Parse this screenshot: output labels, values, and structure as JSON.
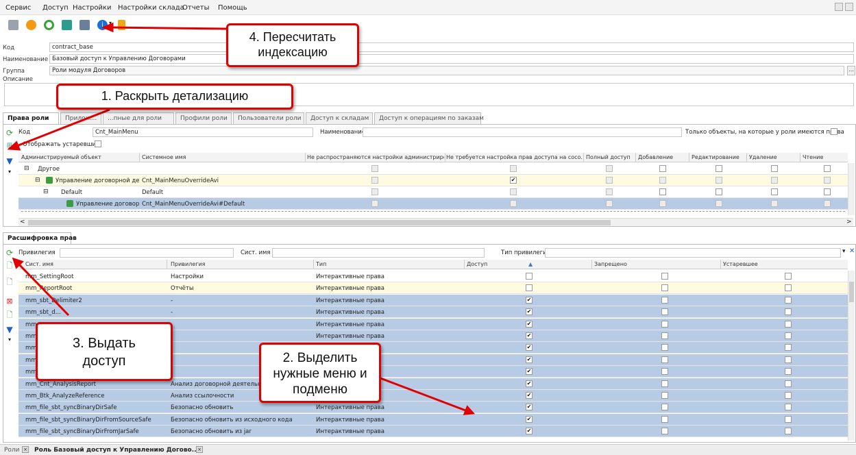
{
  "menu": [
    "Сервис",
    "Доступ",
    "Настройки",
    "Настройки склада",
    "Отчеты",
    "Помощь"
  ],
  "form": {
    "code_label": "Код",
    "code_value": "contract_base",
    "name_label": "Наименование",
    "name_value": "Базовый доступ к Управлению Договорами",
    "group_label": "Группа",
    "group_value": "Роли модуля Договоров",
    "desc_label": "Описание",
    "group_btn": "..."
  },
  "tabs_top": [
    "Права роли",
    "Прилож...",
    "...пные для роли",
    "Профили роли",
    "Пользователи роли",
    "Доступ к складам",
    "Доступ к операциям по заказам"
  ],
  "filter_top": {
    "code_label": "Код",
    "code_value": "Cnt_MainMenu",
    "name_label": "Наименование",
    "only_label": "Только объекты, на которые у роли имеются права",
    "show_obsolete": "Отображать устаревшие"
  },
  "grid1": {
    "columns": [
      "Администрируемый объект",
      "Системное имя",
      "Не распространяются настройки администриро...",
      "Не требуется настройка прав доступа на сосo...",
      "Полный доступ",
      "Добавление",
      "Редактирование",
      "Удаление",
      "Чтение"
    ],
    "rows": [
      {
        "obj": "Другое",
        "sys": ""
      },
      {
        "obj": "Управление договорной деятел",
        "sys": "Cnt_MainMenuOverrideAvi"
      },
      {
        "obj": "Default",
        "sys": "Default"
      },
      {
        "obj": "Управление договорной",
        "sys": "Cnt_MainMenuOverrideAvi#Default"
      }
    ]
  },
  "tab_bottom": "Расшифровка прав",
  "filter_bottom": {
    "priv_label": "Привилегия",
    "sys_label": "Сист. имя",
    "type_label": "Тип привилегии"
  },
  "grid2": {
    "columns": [
      "Сист. имя",
      "Привилегия",
      "Тип",
      "Доступ",
      "Запрещено",
      "Устаревшее"
    ],
    "rows": [
      {
        "sys": "mm_SettingRoot",
        "priv": "Настройки",
        "type": "Интерактивные права",
        "access": false
      },
      {
        "sys": "mm_ReportRoot",
        "priv": "Отчёты",
        "type": "Интерактивные права",
        "access": false
      },
      {
        "sys": "mm_sbt_Delimiter2",
        "priv": "-",
        "type": "Интерактивные права",
        "access": true
      },
      {
        "sys": "mm_sbt_d...",
        "priv": "-",
        "type": "Интерактивные права",
        "access": true
      },
      {
        "sys": "mm",
        "priv": "",
        "type": "Интерактивные права",
        "access": true
      },
      {
        "sys": "mm",
        "priv": "",
        "type": "Интерактивные права",
        "access": true
      },
      {
        "sys": "mm",
        "priv": "",
        "type": "",
        "access": true
      },
      {
        "sys": "mm",
        "priv": "",
        "type": "",
        "access": true
      },
      {
        "sys": "mm_file_sbt_Delimiter3",
        "priv": "-",
        "type": "",
        "access": true
      },
      {
        "sys": "mm_Cnt_AnalysisReport",
        "priv": "Анализ договорной деятельност",
        "type": "",
        "access": true
      },
      {
        "sys": "mm_Btk_AnalyzeReference",
        "priv": "Анализ ссылочности",
        "type": "",
        "access": true
      },
      {
        "sys": "mm_file_sbt_syncBinaryDirSafe",
        "priv": "Безопасно обновить",
        "type": "Интерактивные права",
        "access": true
      },
      {
        "sys": "mm_file_sbt_syncBinaryDirFromSourceSafe",
        "priv": "Безопасно обновить из исходного кода",
        "type": "Интерактивные права",
        "access": true
      },
      {
        "sys": "mm_file_sbt_syncBinaryDirFromJarSafe",
        "priv": "Безопасно обновить из jar",
        "type": "Интерактивные права",
        "access": true
      }
    ]
  },
  "callouts": {
    "c1": "1. Раскрыть детализацию",
    "c2": "2. Выделить нужные меню и подменю",
    "c3": "3. Выдать доступ",
    "c4": "4. Пересчитать индексацию"
  },
  "bottom_tabs": [
    "Роли",
    "Роль Базовый доступ к Управлению Догово..."
  ],
  "colors": {
    "selection": "#b7cbe4",
    "callout_border": "#e00000",
    "highlight_row": "#fffbe0"
  }
}
